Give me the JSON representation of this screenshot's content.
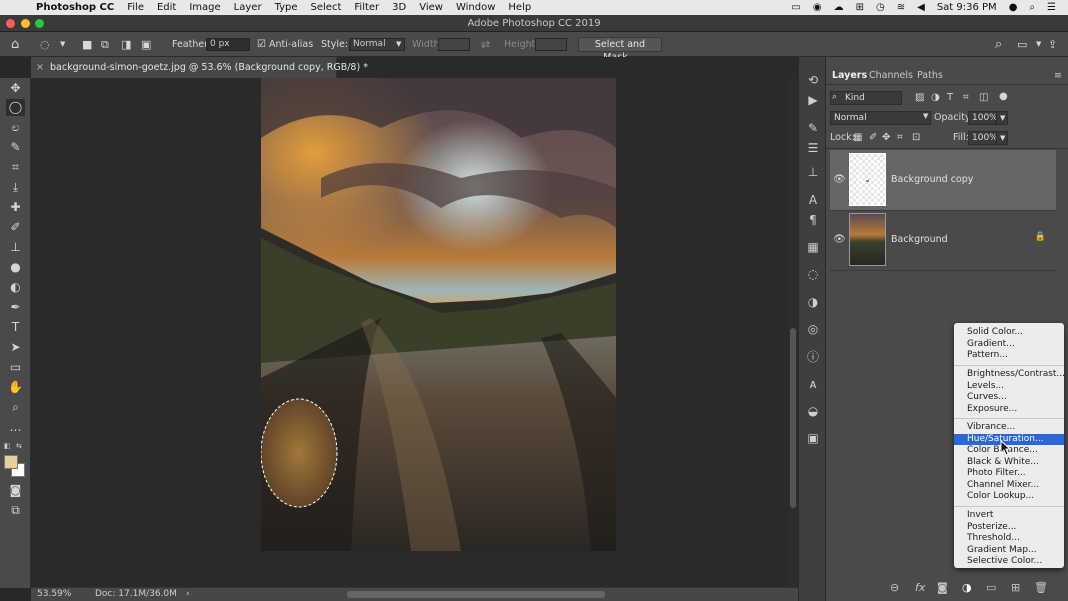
{
  "menubar": {
    "app_name": "Photoshop CC",
    "items": [
      "File",
      "Edit",
      "Image",
      "Layer",
      "Type",
      "Select",
      "Filter",
      "3D",
      "View",
      "Window",
      "Help"
    ],
    "clock": "Sat 9:36 PM"
  },
  "window": {
    "title": "Adobe Photoshop CC 2019"
  },
  "options_bar": {
    "feather_label": "Feather:",
    "feather_value": "0 px",
    "anti_alias_label": "Anti-alias",
    "style_label": "Style:",
    "style_value": "Normal",
    "width_label": "Width:",
    "height_label": "Height:",
    "select_mask_label": "Select and Mask..."
  },
  "document": {
    "tab_title": "background-simon-goetz.jpg @ 53.6% (Background copy, RGB/8) *",
    "zoom": "53.59%",
    "doc_size": "Doc: 17.1M/36.0M"
  },
  "panel": {
    "tabs": [
      "Layers",
      "Channels",
      "Paths"
    ],
    "filter_kind": "Kind",
    "blend_mode": "Normal",
    "opacity_label": "Opacity:",
    "opacity_value": "100%",
    "lock_label": "Lock:",
    "fill_label": "Fill:",
    "fill_value": "100%",
    "layers": [
      {
        "name": "Background copy"
      },
      {
        "name": "Background"
      }
    ]
  },
  "adjustment_menu": {
    "group1": [
      "Solid Color...",
      "Gradient...",
      "Pattern..."
    ],
    "group2": [
      "Brightness/Contrast...",
      "Levels...",
      "Curves...",
      "Exposure..."
    ],
    "group3": [
      "Vibrance...",
      "Hue/Saturation...",
      "Color Balance...",
      "Black & White...",
      "Photo Filter...",
      "Channel Mixer...",
      "Color Lookup..."
    ],
    "group4": [
      "Invert",
      "Posterize...",
      "Threshold...",
      "Gradient Map...",
      "Selective Color..."
    ],
    "highlighted": "Hue/Saturation..."
  },
  "colors": {
    "accent": "#2b67d6",
    "panel_bg": "#4a4a4a",
    "canvas_bg": "#2a2a2a"
  }
}
